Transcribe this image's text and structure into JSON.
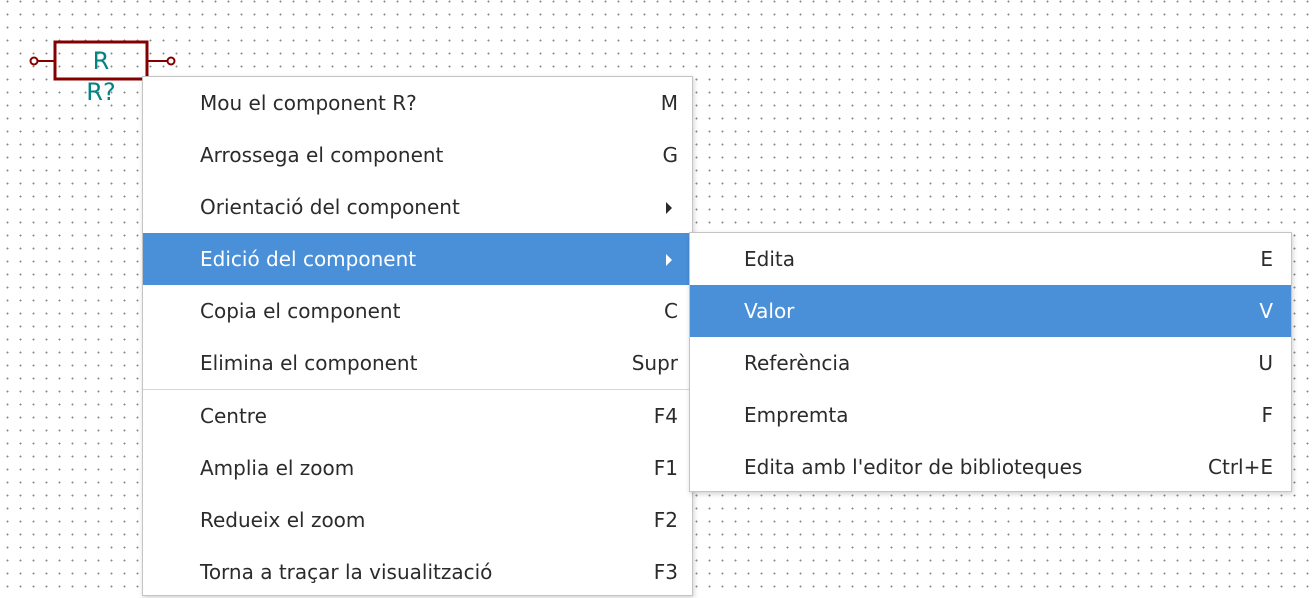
{
  "schematic": {
    "component_value": "R",
    "component_reference": "R?",
    "colors": {
      "body": "#840000",
      "text": "#008484"
    }
  },
  "context_menu": {
    "items": [
      {
        "label": "Mou el component R?",
        "shortcut": "M"
      },
      {
        "label": "Arrossega el component",
        "shortcut": "G"
      },
      {
        "label": "Orientació del component",
        "submenu": true
      },
      {
        "label": "Edició del component",
        "submenu": true,
        "active": true
      },
      {
        "label": "Copia el component",
        "shortcut": "C"
      },
      {
        "label": "Elimina el component",
        "shortcut": "Supr"
      },
      {
        "label": "Centre",
        "shortcut": "F4"
      },
      {
        "label": "Amplia el zoom",
        "shortcut": "F1"
      },
      {
        "label": "Redueix el zoom",
        "shortcut": "F2"
      },
      {
        "label": "Torna a traçar la visualització",
        "shortcut": "F3"
      }
    ]
  },
  "submenu": {
    "items": [
      {
        "label": "Edita",
        "shortcut": "E"
      },
      {
        "label": "Valor",
        "shortcut": "V",
        "active": true
      },
      {
        "label": "Referència",
        "shortcut": "U"
      },
      {
        "label": "Empremta",
        "shortcut": "F"
      },
      {
        "label": "Edita amb l'editor de biblioteques",
        "shortcut": "Ctrl+E"
      }
    ]
  },
  "accent_color": "#4a90d9"
}
